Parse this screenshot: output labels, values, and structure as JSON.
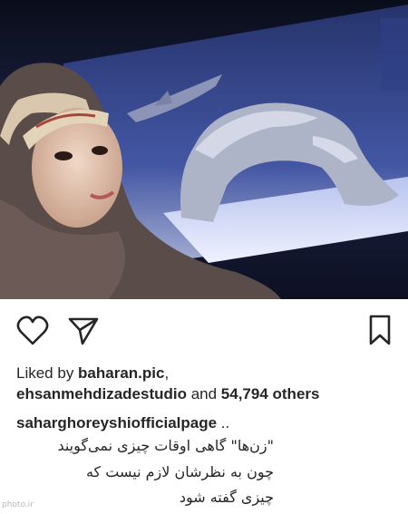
{
  "post": {
    "photo": {
      "description_icon": "post-photo"
    },
    "actions": {
      "like_icon": "heart-icon",
      "share_icon": "send-icon",
      "save_icon": "bookmark-icon"
    },
    "likes": {
      "prefix": "Liked by ",
      "user1": "baharan.pic",
      "separator": ",",
      "user2": "ehsanmehdizadestudio",
      "and_text": " and ",
      "count": "54,794 others"
    },
    "caption": {
      "username": "saharghoreyshiofficialpage",
      "suffix": " ..",
      "lines": [
        "\"زن‌ها\" گاهی اوقات چیزی نمی‌گویند",
        "چون به نظرشان لازم نیست که",
        "چیزی گفته شود"
      ]
    },
    "watermark": "photo.ir"
  },
  "colors": {
    "text": "#262626",
    "background": "#ffffff"
  }
}
